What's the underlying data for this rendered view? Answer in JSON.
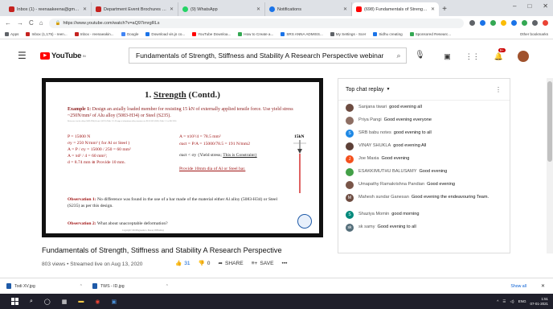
{
  "browser": {
    "tabs": [
      {
        "title": "Inbox (1) - reenaakeena@gmail.c",
        "color": "#c5221f"
      },
      {
        "title": "Department Event Brochures - Pr",
        "color": "#c5221f"
      },
      {
        "title": "(9) WhatsApp",
        "color": "#25d366"
      },
      {
        "title": "Notifications",
        "color": "#1a73e8"
      },
      {
        "title": "(698) Fundamentals of Strength...",
        "color": "#ff0000"
      }
    ],
    "new_tab": "+",
    "window_controls": [
      "–",
      "□",
      "✕"
    ],
    "nav": {
      "back": "←",
      "forward": "→",
      "reload": "C",
      "home": "⌂"
    },
    "url": "https://www.youtube.com/watch?v=aQ97imrgRLs",
    "extension_colors": [
      "#5f6368",
      "#1a73e8",
      "#34a853",
      "#fbbc05",
      "#1a73e8",
      "#34a853",
      "#5f6368",
      "#ea4335"
    ],
    "bookmarks": [
      {
        "label": "Apps",
        "color": "#5f6368"
      },
      {
        "label": "Inbox (1,175) - reen...",
        "color": "#c5221f"
      },
      {
        "label": "Inbox - reenaeakin...",
        "color": "#c5221f"
      },
      {
        "label": "Google",
        "color": "#4285f4"
      },
      {
        "label": "Download vis.js co...",
        "color": "#1a73e8"
      },
      {
        "label": "YouTube Downloa...",
        "color": "#ff0000"
      },
      {
        "label": "How to Create a...",
        "color": "#34a853"
      },
      {
        "label": "SRS ANNA ADMISS...",
        "color": "#1a73e8"
      },
      {
        "label": "My Settings - Scer",
        "color": "#5f6368"
      },
      {
        "label": "Sidhu creating",
        "color": "#1a73e8"
      },
      {
        "label": "Sponsored Researc...",
        "color": "#34a853"
      }
    ],
    "other_bookmarks": "Other bookmarks"
  },
  "youtube": {
    "logo_text": "YouTube",
    "logo_sup": "IN",
    "search_query": "Fundamentals of Strength, Stiffness and Stability A Research Perspective webinar",
    "notification_count": "9+"
  },
  "slide": {
    "title_prefix": "1. ",
    "title_underlined": "Strength",
    "title_suffix": " (Contd.)",
    "example_label": "Example 1:",
    "example_text": "Design an axially loaded member for resisting 15 kN of externally applied tensile force. Use yield stress ~250N/mm² of Alu alloy (5083-H34) or Steel (S235).",
    "reference": "Reference for the alloy (5083-H34) & steel (S235) Table 3.2; Design of aluminium alloy structures to BS 8118/2 (BSI); Table 3.1 of BS 5950",
    "left_lines": [
      "P = 15000 N",
      "σy = 250 N/mm² ( for Al or Steel )",
      "A = P / σy = 15000 / 250 = 60 mm²",
      "A = πd² / 4 = 60 mm²;",
      "d = 8.74 mm ≅ Provide 10 mm."
    ],
    "mid_lines": [
      "A = π10²/4 = 78.5 mm²",
      "σact = P/A = 15000/78.5 = 191 N/mm2"
    ],
    "constraint_pre": "σact < σy {Yield stress;",
    "constraint_link": "This is Constraint}",
    "provide": "Provide 10mm dia of Al or Steel bar.",
    "force_label": "15kN",
    "obs1_label": "Observation 1:",
    "obs1_text": "No difference was found in the use of a bar made of the material either Al alloy (5083-H34) or Steel (S235) as per this design.",
    "obs2_label": "Observation 2:",
    "obs2_text": "What about unacceptable deformation?",
    "copyright": "Copyright©2019EngAssist.L. Prasad, IITBombay"
  },
  "video": {
    "title": "Fundamentals of Strength, Stiffness and Stability A Research Perspective",
    "meta": "803 views • Streamed live on Aug 13, 2020",
    "likes": "31",
    "dislikes": "0",
    "share": "SHARE",
    "save": "SAVE",
    "more": "•••"
  },
  "chat": {
    "header": "Top chat replay",
    "messages": [
      {
        "author": "Sanjana tiwari",
        "text": "good evening all",
        "color": "#6d4c41",
        "initial": ""
      },
      {
        "author": "Priya Pangi",
        "text": "Good evening everyone",
        "color": "#8d6e63",
        "initial": ""
      },
      {
        "author": "SRB babu notes",
        "text": "good evening to all",
        "color": "#1e88e5",
        "initial": "S"
      },
      {
        "author": "VINAY SHUKLA",
        "text": "good evening All",
        "color": "#5d4037",
        "initial": ""
      },
      {
        "author": "Joe Maxia",
        "text": "Good evening",
        "color": "#f4511e",
        "initial": "J"
      },
      {
        "author": "ESAKKIMUTHU BALUSAMY",
        "text": "Good evening",
        "color": "#43a047",
        "initial": ""
      },
      {
        "author": "Umapathy Ramakrishna Pandian",
        "text": "Good evening",
        "color": "#795548",
        "initial": ""
      },
      {
        "author": "Mahesh sundar Ganesan",
        "text": "Good evening the endeavouring Team.",
        "color": "#6d4c41",
        "initial": "M"
      },
      {
        "author": "Shaziya Momin",
        "text": "good morning",
        "color": "#00897b",
        "initial": "S"
      },
      {
        "author": "sk samy",
        "text": "Good evening to all",
        "color": "#546e7a",
        "initial": "sk"
      }
    ]
  },
  "downloads": {
    "items": [
      "Todi XV.jpg",
      "TWS - ID.jpg"
    ],
    "show_all": "Show all"
  },
  "taskbar": {
    "lang": "ENG",
    "time": "1:51",
    "date": "07-01-2021"
  }
}
